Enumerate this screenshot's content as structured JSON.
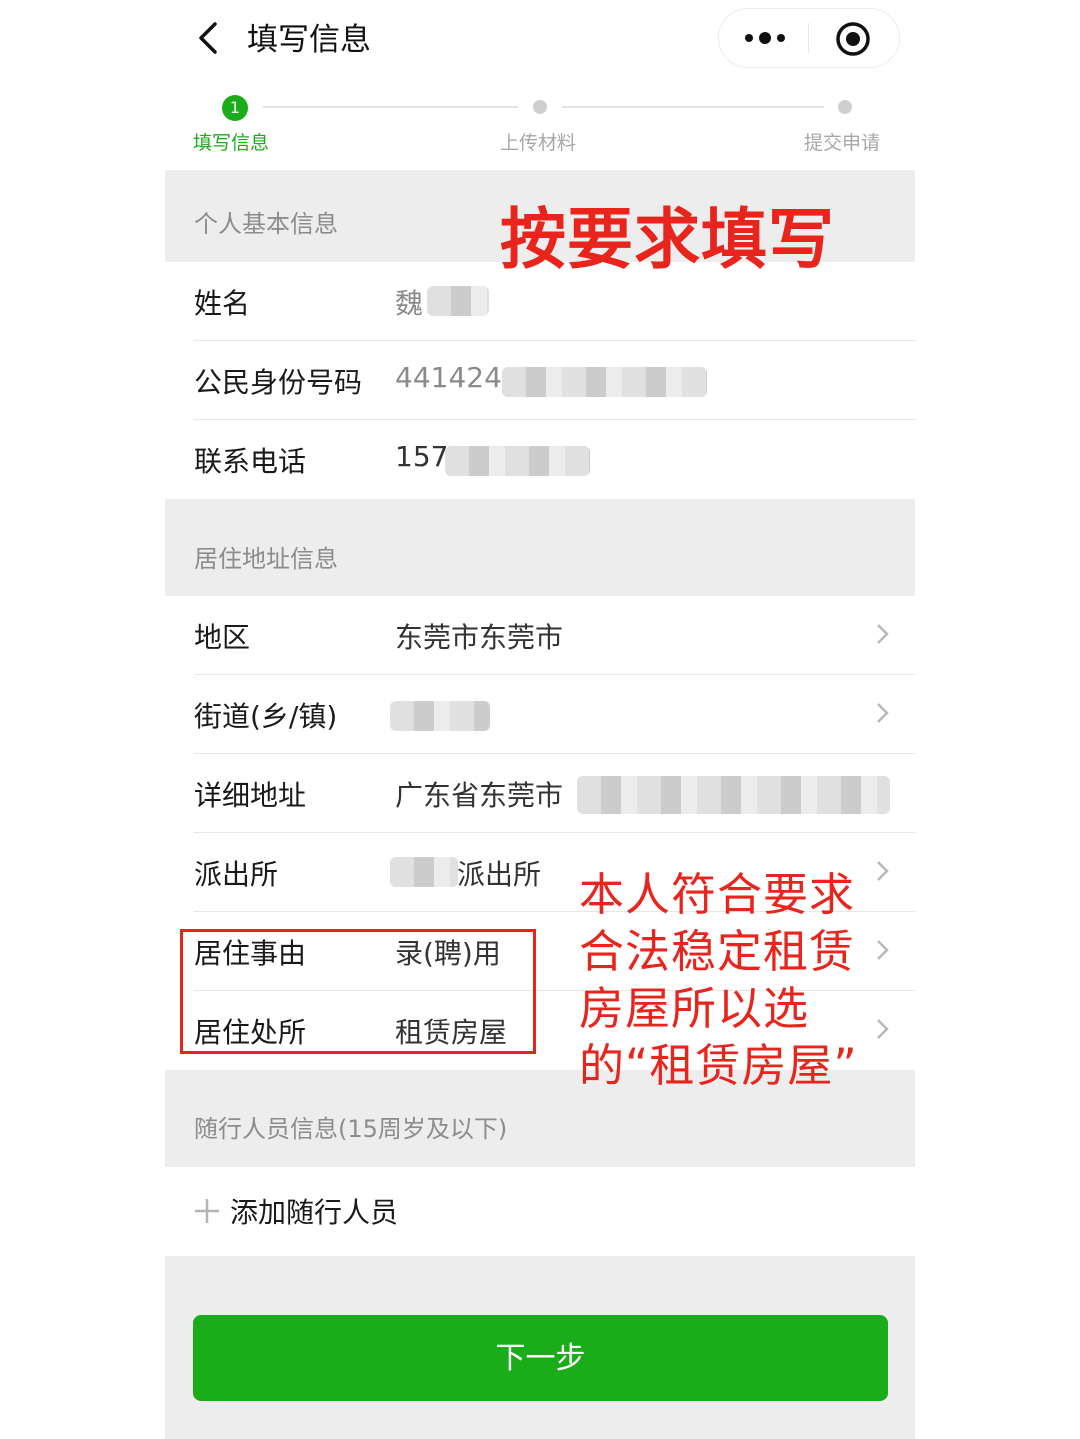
{
  "nav": {
    "title": "填写信息"
  },
  "steps": [
    {
      "number": "1",
      "label": "填写信息",
      "active": true
    },
    {
      "label": "上传材料",
      "active": false
    },
    {
      "label": "提交申请",
      "active": false
    }
  ],
  "personal": {
    "section_title": "个人基本信息",
    "rows": [
      {
        "label": "姓名",
        "value": "魏"
      },
      {
        "label": "公民身份号码",
        "value": "441424"
      },
      {
        "label": "联系电话",
        "value": "157"
      }
    ]
  },
  "address": {
    "section_title": "居住地址信息",
    "rows": [
      {
        "label": "地区",
        "value": "东莞市东莞市"
      },
      {
        "label": "街道(乡/镇)",
        "value": ""
      },
      {
        "label": "详细地址",
        "value": "广东省东莞市"
      },
      {
        "label": "派出所",
        "value": "派出所"
      },
      {
        "label": "居住事由",
        "value": "录(聘)用"
      },
      {
        "label": "居住处所",
        "value": "租赁房屋"
      }
    ]
  },
  "companions": {
    "section_title": "随行人员信息(15周岁及以下)",
    "add_label": "添加随行人员"
  },
  "next_button": "下一步",
  "annotations": {
    "title": "按要求填写",
    "note": "本人符合要求合法稳定租赁房屋所以选的“租赁房屋”"
  },
  "colors": {
    "accent": "#1aad19",
    "annotation": "#e8241c"
  }
}
